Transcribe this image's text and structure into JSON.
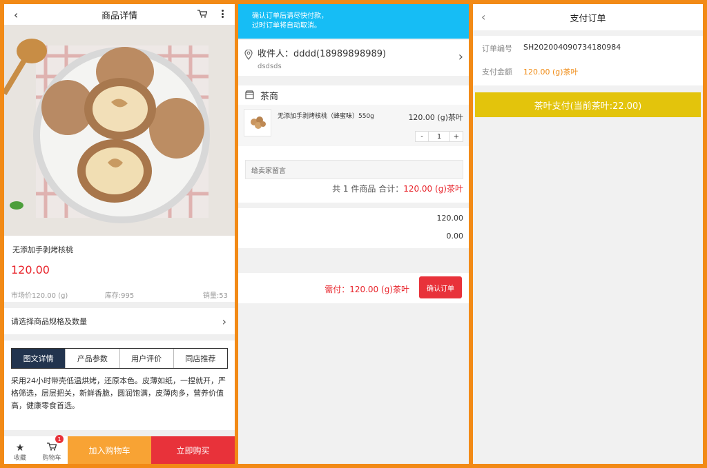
{
  "product_page": {
    "title": "商品详情",
    "name": "无添加手剥烤核桃",
    "price": "120.00",
    "market_price": "市场价120.00 (g)",
    "stock": "库存:995",
    "sales": "销量:53",
    "spec_prompt": "请选择商品规格及数量",
    "tabs": [
      "图文详情",
      "产品参数",
      "用户评价",
      "同店推荐"
    ],
    "description": "采用24小时带壳低温烘烤，还原本色。皮薄如纸，一捏就开，严格筛选，层层把关，新鲜香脆，圆润饱满，皮薄肉多，营养价值高，健康零食首选。",
    "bottom": {
      "favorite": "收藏",
      "cart": "购物车",
      "cart_badge": "1",
      "add_cart": "加入购物车",
      "buy_now": "立即购买"
    }
  },
  "confirm_page": {
    "notice_line1": "确认订单后请尽快付款，",
    "notice_line2": "过时订单将自动取消。",
    "receiver": "收件人：dddd(18989898989)",
    "address": "dsdsds",
    "shop_name": "茶商",
    "item_name": "无添加手剥烤核桃（蜂蜜味）550g",
    "item_price": "120.00 (g)茶叶",
    "quantity": "1",
    "minus": "-",
    "plus": "+",
    "message_placeholder": "给卖家留言",
    "total_prefix": "共 1 件商品 合计：",
    "total_value": "120.00 (g)茶叶",
    "summary_value1": "120.00",
    "summary_value2": "0.00",
    "need_pay": "需付：120.00 (g)茶叶",
    "confirm_button": "确认订单"
  },
  "pay_page": {
    "title": "支付订单",
    "order_label": "订单编号",
    "order_value": "SH202004090734180984",
    "amount_label": "支付金额",
    "amount_value": "120.00 (g)茶叶",
    "pay_button": "茶叶支付(当前茶叶:22.00)"
  },
  "colors": {
    "frame": "#f28a16",
    "red": "#e8242b",
    "notice_blue": "#16bdf5",
    "pay_yellow": "#e3c40c",
    "tab_active": "#22344e",
    "add_cart_orange": "#f8a334"
  }
}
